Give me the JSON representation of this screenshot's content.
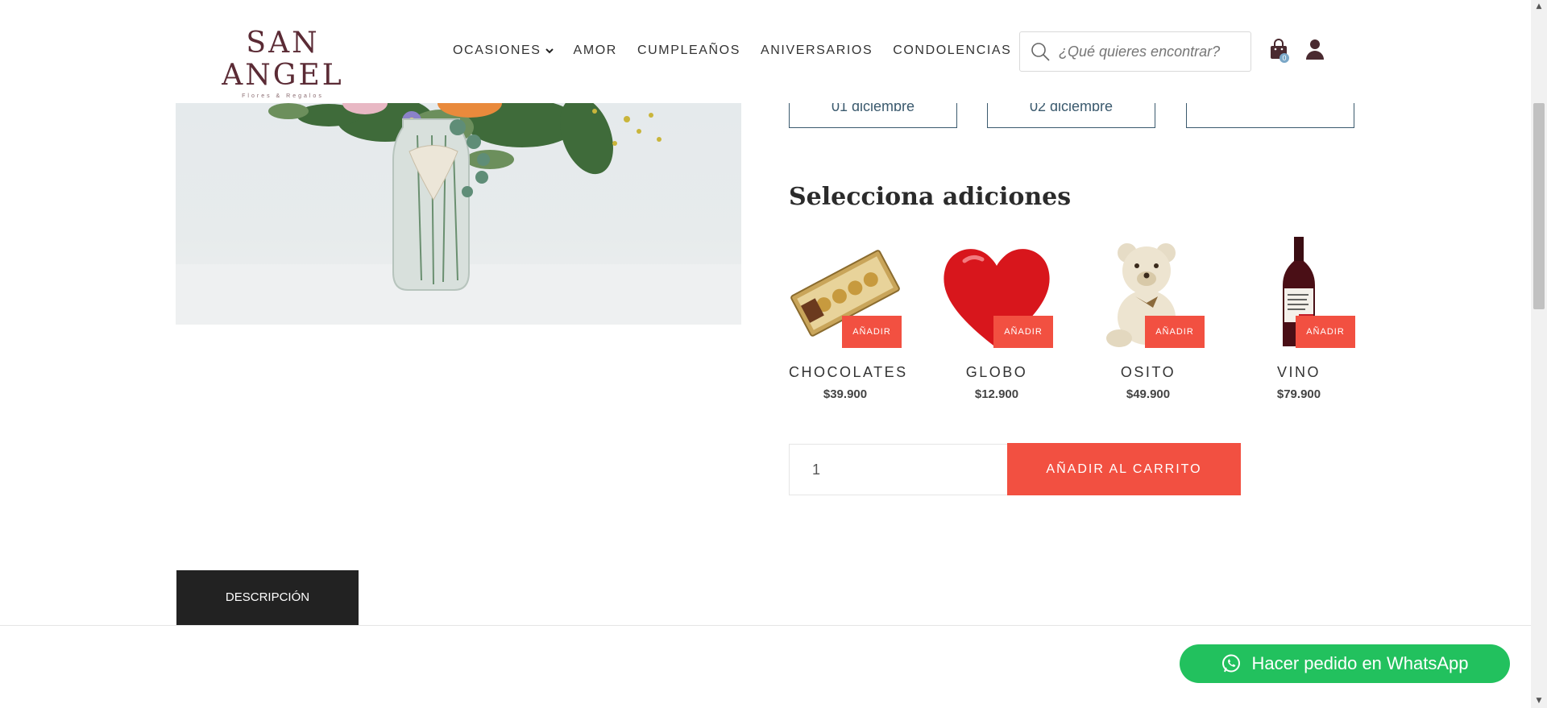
{
  "header": {
    "logo_main": "SAN ANGEL",
    "logo_sub": "Flores & Regalos",
    "nav": [
      {
        "label": "OCASIONES"
      },
      {
        "label": "AMOR"
      },
      {
        "label": "CUMPLEAÑOS"
      },
      {
        "label": "ANIVERSARIOS"
      },
      {
        "label": "CONDOLENCIAS"
      }
    ],
    "search_placeholder": "¿Qué quieres encontrar?",
    "cart_count": "0"
  },
  "delivery_dates": [
    {
      "label": "01 diciembre"
    },
    {
      "label": "02 diciembre"
    },
    {
      "label": ""
    }
  ],
  "addons": {
    "title": "Selecciona adiciones",
    "items": [
      {
        "name": "CHOCOLATES",
        "price": "$39.900",
        "button": "AÑADIR"
      },
      {
        "name": "GLOBO",
        "price": "$12.900",
        "button": "AÑADIR"
      },
      {
        "name": "OSITO",
        "price": "$49.900",
        "button": "AÑADIR"
      },
      {
        "name": "VINO",
        "price": "$79.900",
        "button": "AÑADIR"
      }
    ]
  },
  "purchase": {
    "quantity": "1",
    "add_to_cart": "AÑADIR AL CARRITO"
  },
  "tabs": {
    "description": "DESCRIPCIÓN"
  },
  "whatsapp": {
    "label": "Hacer pedido en WhatsApp"
  },
  "colors": {
    "accent": "#f25041",
    "whatsapp": "#22c15e",
    "date_border": "#3b5a6e",
    "logo": "#5b2b35"
  }
}
